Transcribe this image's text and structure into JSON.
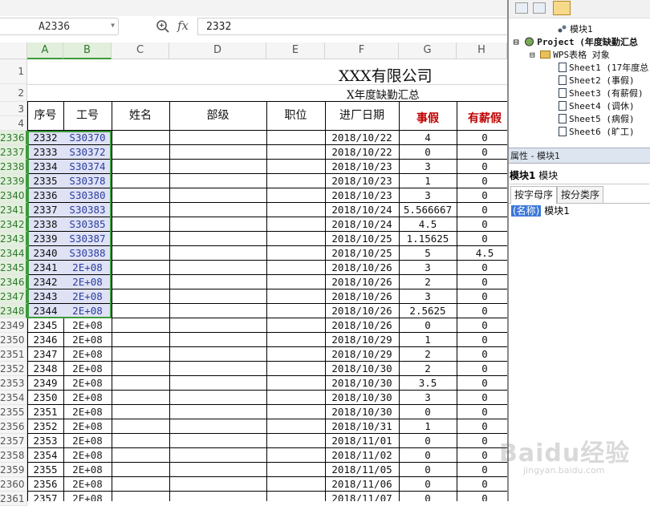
{
  "formula_bar": {
    "name_box": "A2336",
    "fx_label": "fx",
    "formula_value": "2332"
  },
  "columns": [
    "A",
    "B",
    "C",
    "D",
    "E",
    "F",
    "G",
    "H"
  ],
  "top_rows": [
    "1",
    "2",
    "3",
    "4"
  ],
  "sheet": {
    "title": "XXX有限公司",
    "subtitle": "X年度缺勤汇总",
    "headers": {
      "seq": "序号",
      "emp_id": "工号",
      "name": "姓名",
      "dept": "部级",
      "position": "职位",
      "join_date": "进厂日期",
      "personal_leave": "事假",
      "paid_leave": "有薪假"
    },
    "rows": [
      {
        "row": "2336",
        "seq": "2332",
        "emp_id": "S30370",
        "date": "2018/10/22",
        "personal": "4",
        "paid": "0"
      },
      {
        "row": "2337",
        "seq": "2333",
        "emp_id": "S30372",
        "date": "2018/10/22",
        "personal": "0",
        "paid": "0"
      },
      {
        "row": "2338",
        "seq": "2334",
        "emp_id": "S30374",
        "date": "2018/10/23",
        "personal": "3",
        "paid": "0"
      },
      {
        "row": "2339",
        "seq": "2335",
        "emp_id": "S30378",
        "date": "2018/10/23",
        "personal": "1",
        "paid": "0"
      },
      {
        "row": "2340",
        "seq": "2336",
        "emp_id": "S30380",
        "date": "2018/10/23",
        "personal": "3",
        "paid": "0"
      },
      {
        "row": "2341",
        "seq": "2337",
        "emp_id": "S30383",
        "date": "2018/10/24",
        "personal": "5.566667",
        "paid": "0"
      },
      {
        "row": "2342",
        "seq": "2338",
        "emp_id": "S30385",
        "date": "2018/10/24",
        "personal": "4.5",
        "paid": "0"
      },
      {
        "row": "2343",
        "seq": "2339",
        "emp_id": "S30387",
        "date": "2018/10/25",
        "personal": "1.15625",
        "paid": "0"
      },
      {
        "row": "2344",
        "seq": "2340",
        "emp_id": "S30388",
        "date": "2018/10/25",
        "personal": "5",
        "paid": "4.5"
      },
      {
        "row": "2345",
        "seq": "2341",
        "emp_id": "2E+08",
        "date": "2018/10/26",
        "personal": "3",
        "paid": "0"
      },
      {
        "row": "2346",
        "seq": "2342",
        "emp_id": "2E+08",
        "date": "2018/10/26",
        "personal": "2",
        "paid": "0"
      },
      {
        "row": "2347",
        "seq": "2343",
        "emp_id": "2E+08",
        "date": "2018/10/26",
        "personal": "3",
        "paid": "0"
      },
      {
        "row": "2348",
        "seq": "2344",
        "emp_id": "2E+08",
        "date": "2018/10/26",
        "personal": "2.5625",
        "paid": "0"
      },
      {
        "row": "2349",
        "seq": "2345",
        "emp_id": "2E+08",
        "date": "2018/10/26",
        "personal": "0",
        "paid": "0"
      },
      {
        "row": "2350",
        "seq": "2346",
        "emp_id": "2E+08",
        "date": "2018/10/29",
        "personal": "1",
        "paid": "0"
      },
      {
        "row": "2351",
        "seq": "2347",
        "emp_id": "2E+08",
        "date": "2018/10/29",
        "personal": "2",
        "paid": "0"
      },
      {
        "row": "2352",
        "seq": "2348",
        "emp_id": "2E+08",
        "date": "2018/10/30",
        "personal": "2",
        "paid": "0"
      },
      {
        "row": "2353",
        "seq": "2349",
        "emp_id": "2E+08",
        "date": "2018/10/30",
        "personal": "3.5",
        "paid": "0"
      },
      {
        "row": "2354",
        "seq": "2350",
        "emp_id": "2E+08",
        "date": "2018/10/30",
        "personal": "3",
        "paid": "0"
      },
      {
        "row": "2355",
        "seq": "2351",
        "emp_id": "2E+08",
        "date": "2018/10/30",
        "personal": "0",
        "paid": "0"
      },
      {
        "row": "2356",
        "seq": "2352",
        "emp_id": "2E+08",
        "date": "2018/10/31",
        "personal": "1",
        "paid": "0"
      },
      {
        "row": "2357",
        "seq": "2353",
        "emp_id": "2E+08",
        "date": "2018/11/01",
        "personal": "0",
        "paid": "0"
      },
      {
        "row": "2358",
        "seq": "2354",
        "emp_id": "2E+08",
        "date": "2018/11/02",
        "personal": "0",
        "paid": "0"
      },
      {
        "row": "2359",
        "seq": "2355",
        "emp_id": "2E+08",
        "date": "2018/11/05",
        "personal": "0",
        "paid": "0"
      },
      {
        "row": "2360",
        "seq": "2356",
        "emp_id": "2E+08",
        "date": "2018/11/06",
        "personal": "0",
        "paid": "0"
      },
      {
        "row": "2361",
        "seq": "2357",
        "emp_id": "2E+08",
        "date": "2018/11/07",
        "personal": "0",
        "paid": "0"
      }
    ],
    "selected_rows": [
      "2336",
      "2337",
      "2338",
      "2339",
      "2340",
      "2341",
      "2342",
      "2343",
      "2344",
      "2345",
      "2346",
      "2347",
      "2348"
    ]
  },
  "vba": {
    "tree": {
      "module": "模块1",
      "project": "Project (年度缺勤汇总",
      "wps_objects": "WPS表格 对象",
      "sheets": [
        "Sheet1 (17年度总",
        "Sheet2 (事假)",
        "Sheet3 (有薪假)",
        "Sheet4 (调休)",
        "Sheet5 (病假)",
        "Sheet6 (旷工)"
      ]
    },
    "properties": {
      "title": "属性 - 模块1",
      "object_name": "模块1",
      "object_type": "模块",
      "tab_alpha": "按字母序",
      "tab_category": "按分类序",
      "prop_key": "(名称)",
      "prop_value": "模块1"
    }
  },
  "watermark": {
    "text": "Baidu经验",
    "sub": "jingyan.baidu.com"
  },
  "colors": {
    "selection_green": "#3c9a3c",
    "selected_cell_fill": "#dfe2f5",
    "header_red": "#c00000"
  }
}
